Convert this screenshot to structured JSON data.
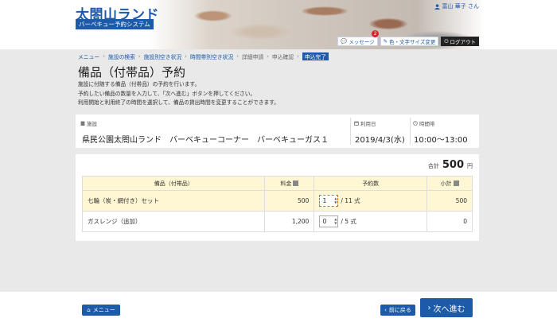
{
  "header": {
    "site_title": "太閤山ランド",
    "site_subtitle": "バーベキュー予約システム",
    "user_name": "富山 華子 さん",
    "message_label": "メッセージ",
    "message_count": "2",
    "display_label": "色・文字サイズ変更",
    "logout_label": "ログアウト"
  },
  "breadcrumb": {
    "items": [
      "メニュー",
      "施設の検索",
      "施設別空き状況",
      "時間帯別空き状況",
      "詳細申請",
      "申込確認",
      "申込完了"
    ]
  },
  "page": {
    "title": "備品（付帯品）予約",
    "intro": [
      "施設に付随する備品（付帯品）の予約を行います。",
      "予約したい備品の数量を入力して、「次へ進む」ボタンを押してください。",
      "利用開始と利用終了の時間を選択して、備品の貸出時間を変更することができます。"
    ]
  },
  "reservation": {
    "facility_label": "施設",
    "facility_value": "県民公園太閤山ランド　バーベキューコーナー　バーベキューガス１",
    "date_label": "利用日",
    "date_value": "2019/4/3(水)",
    "time_label": "時間帯",
    "time_value": "10:00～13:00"
  },
  "equipment": {
    "total_label": "合計",
    "total_value": "500",
    "total_unit": "円",
    "columns": [
      "備品（付帯品）",
      "料金",
      "予約数",
      "小計"
    ],
    "rows": [
      {
        "name": "七輪（炭・網付き）セット",
        "price": "500",
        "qty": "1",
        "stock": "/ 11 式",
        "subtotal": "500"
      },
      {
        "name": "ガスレンジ（追加）",
        "price": "1,200",
        "qty": "0",
        "stock": "/ 5 式",
        "subtotal": "0"
      }
    ]
  },
  "footer": {
    "menu_label": "メニュー",
    "back_label": "前に戻る",
    "next_label": "次へ進む"
  },
  "colors": {
    "accent": "#1d5aa8",
    "highlight": "#fff6d4"
  }
}
